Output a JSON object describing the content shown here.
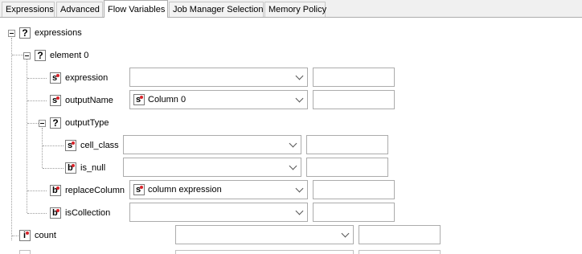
{
  "tabs": [
    "Expressions",
    "Advanced",
    "Flow Variables",
    "Job Manager Selection",
    "Memory Policy"
  ],
  "active_tab": "Flow Variables",
  "tree": {
    "expressions": "expressions",
    "element0": "element 0",
    "expression": "expression",
    "outputName": "outputName",
    "outputName_value": "Column 0",
    "outputType": "outputType",
    "cell_class": "cell_class",
    "is_null": "is_null",
    "replaceColumn": "replaceColumn",
    "replaceColumn_value": "column expression",
    "isCollection": "isCollection",
    "count": "count"
  },
  "type_badges": {
    "question": "?",
    "string": "s",
    "boolean": "b",
    "integer": "i"
  },
  "colors": {
    "badge_dot": "#d8232a",
    "active_tab_bg": "#ffffff",
    "panel_bg": "#ffffff"
  }
}
